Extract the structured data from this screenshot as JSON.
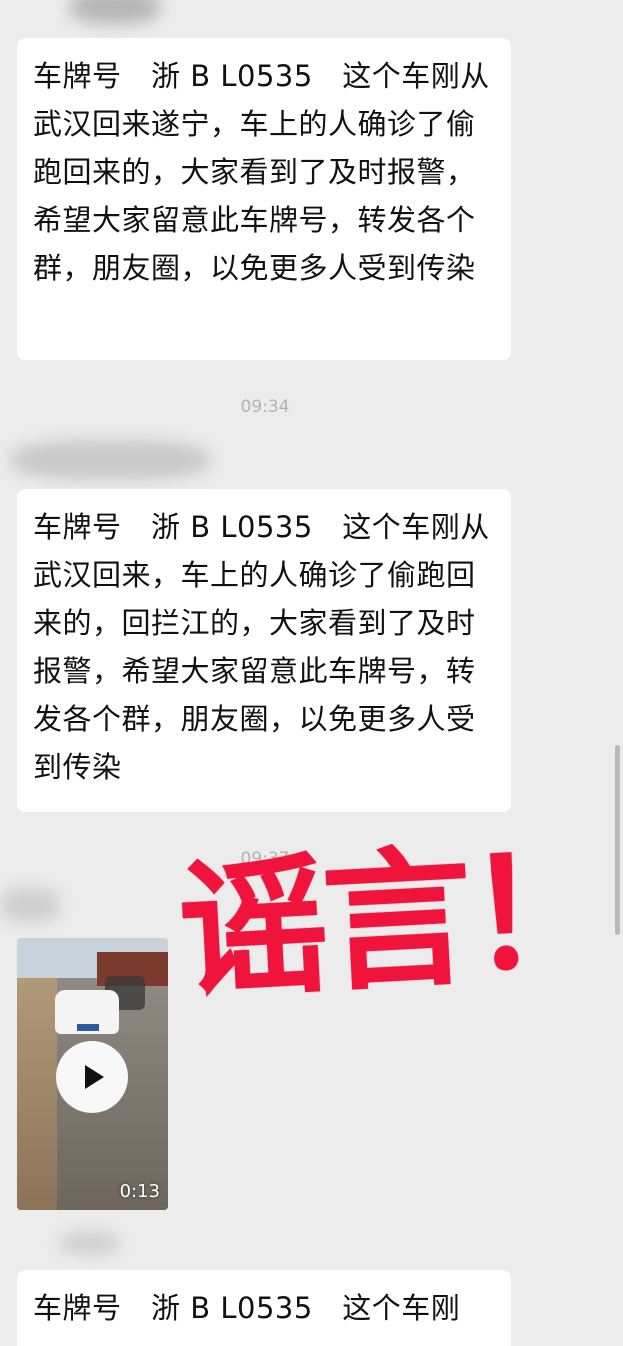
{
  "messages": [
    {
      "text": "车牌号　浙 B L0535　这个车刚从武汉回来遂宁，车上的人确诊了偷跑回来的，大家看到了及时报警，希望大家留意此车牌号，转发各个群，朋友圈，以免更多人受到传染"
    },
    {
      "timestamp": "09:34",
      "text": "车牌号　浙 B L0535　这个车刚从武汉回来，车上的人确诊了偷跑回来的，回拦江的，大家看到了及时报警，希望大家留意此车牌号，转发各个群，朋友圈，以免更多人受到传染"
    },
    {
      "timestamp": "09:37",
      "video": {
        "duration": "0:13"
      }
    },
    {
      "text": "车牌号　浙 B L0535　这个车刚"
    }
  ],
  "overlay": {
    "stamp_text": "谣言！",
    "stamp_color": "#f0143c"
  },
  "icons": {
    "play": "play-icon"
  }
}
